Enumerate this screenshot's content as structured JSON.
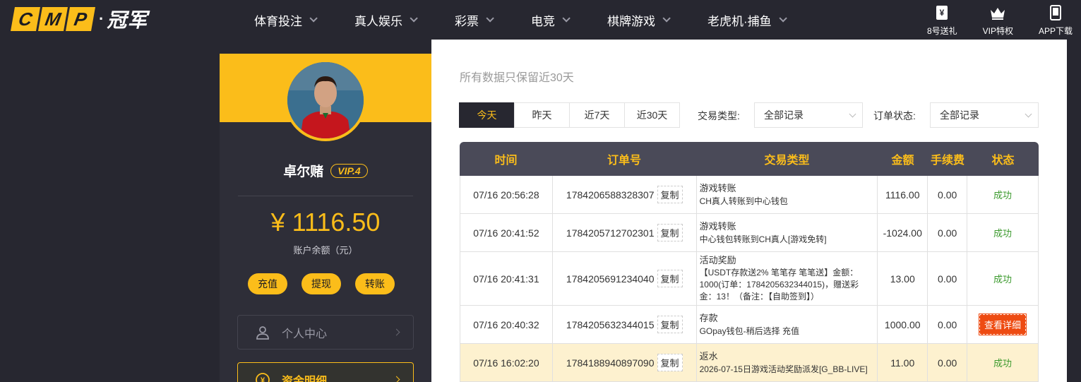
{
  "logo": {
    "letters": [
      "C",
      "M",
      "P"
    ],
    "dot": "·",
    "text": "冠军"
  },
  "nav": [
    {
      "label": "体育投注"
    },
    {
      "label": "真人娱乐"
    },
    {
      "label": "彩票"
    },
    {
      "label": "电竞"
    },
    {
      "label": "棋牌游戏"
    },
    {
      "label": "老虎机·捕鱼"
    }
  ],
  "header_icons": [
    {
      "label": "8号送礼",
      "icon": "gift-yen-icon"
    },
    {
      "label": "VIP特权",
      "icon": "crown-icon"
    },
    {
      "label": "APP下载",
      "icon": "phone-icon"
    }
  ],
  "sidebar": {
    "username": "卓尔赌",
    "vip": "VIP.4",
    "balance": "¥ 1116.50",
    "balance_label": "账户余额（元）",
    "buttons": [
      "充值",
      "提现",
      "转账"
    ],
    "menu": [
      {
        "label": "个人中心",
        "icon": "user-icon"
      },
      {
        "label": "资金明细",
        "icon": "yen-icon"
      }
    ]
  },
  "main": {
    "subtitle": "所有数据只保留近30天",
    "tabs": [
      "今天",
      "昨天",
      "近7天",
      "近30天"
    ],
    "active_tab": 0,
    "filters": {
      "type_label": "交易类型:",
      "type_value": "全部记录",
      "status_label": "订单状态:",
      "status_value": "全部记录"
    },
    "table": {
      "headers": [
        "时间",
        "订单号",
        "交易类型",
        "金额",
        "手续费",
        "状态"
      ],
      "copy_label": "复制",
      "rows": [
        {
          "time": "07/16 20:56:28",
          "order": "1784206588328307",
          "type": "游戏转账",
          "desc": "CH真人转账到中心钱包",
          "amount": "1116.00",
          "fee": "0.00",
          "status": "成功"
        },
        {
          "time": "07/16 20:41:52",
          "order": "1784205712702301",
          "type": "游戏转账",
          "desc": "中心钱包转账到CH真人[游戏免转]",
          "amount": "-1024.00",
          "fee": "0.00",
          "status": "成功"
        },
        {
          "time": "07/16 20:41:31",
          "order": "1784205691234040",
          "type": "活动奖励",
          "desc": "【USDT存款送2% 笔笔存 笔笔送】金额：1000(订单：1784205632344015)，赠送彩金：13！（备注：【自助签到】）",
          "amount": "13.00",
          "fee": "0.00",
          "status": "成功"
        },
        {
          "time": "07/16 20:40:32",
          "order": "1784205632344015",
          "type": "存款",
          "desc": "GOpay钱包-稍后选择 充值",
          "amount": "1000.00",
          "fee": "0.00",
          "status": "查看详细"
        },
        {
          "time": "07/16 16:02:20",
          "order": "1784188940897090",
          "type": "返水",
          "desc": "2026-07-15日游戏活动奖励派发[G_BB-LIVE]",
          "amount": "11.00",
          "fee": "0.00",
          "status": "成功"
        }
      ]
    }
  },
  "colors": {
    "accent": "#fbbd1a",
    "dark": "#272730",
    "success": "#3c9a2e",
    "detail": "#ee4b12"
  }
}
